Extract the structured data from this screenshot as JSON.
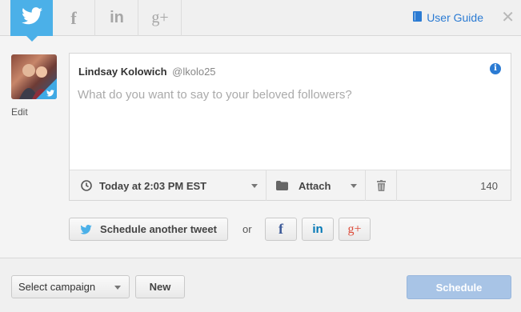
{
  "tabs": [
    {
      "name": "Twitter",
      "glyph": "",
      "active": true
    },
    {
      "name": "Facebook",
      "glyph": "f",
      "active": false
    },
    {
      "name": "LinkedIn",
      "glyph": "in",
      "active": false
    },
    {
      "name": "Google+",
      "glyph": "g+",
      "active": false
    }
  ],
  "header": {
    "user_guide_label": "User Guide",
    "close_glyph": "✕"
  },
  "profile": {
    "edit_label": "Edit"
  },
  "compose": {
    "author_name": "Lindsay Kolowich",
    "author_handle": "@lkolo25",
    "message_value": "",
    "message_placeholder": "What do you want to say to your beloved followers?",
    "schedule_time": "Today at 2:03 PM EST",
    "attach_label": "Attach",
    "char_count": "140"
  },
  "actions": {
    "schedule_another_label": "Schedule another tweet",
    "or_label": "or",
    "networks": [
      {
        "name": "facebook",
        "glyph": "f"
      },
      {
        "name": "linkedin",
        "glyph": "in"
      },
      {
        "name": "google-plus",
        "glyph": "g+"
      }
    ]
  },
  "footer": {
    "campaign_selected": "Select campaign",
    "new_label": "New",
    "schedule_label": "Schedule"
  },
  "colors": {
    "twitter_blue": "#4bb0e8",
    "link_blue": "#2b7bd3",
    "facebook_blue": "#3b5998",
    "linkedin_blue": "#0077b5",
    "google_red": "#dd4b39",
    "schedule_disabled": "#a8c4e6"
  }
}
